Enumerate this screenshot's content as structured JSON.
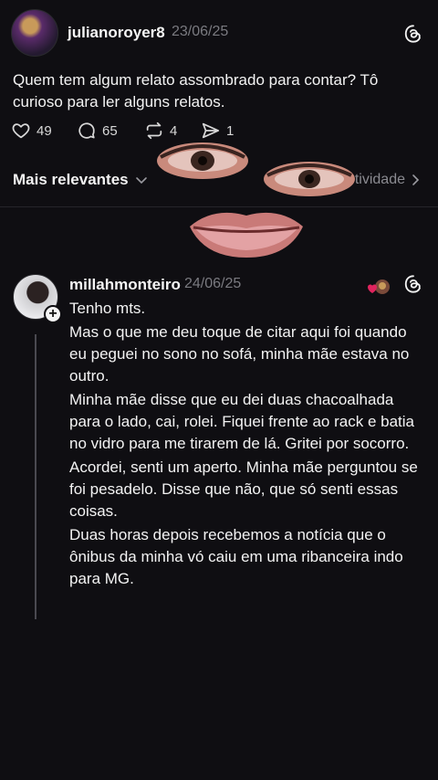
{
  "post": {
    "username": "julianoroyer8",
    "date": "23/06/25",
    "text": "Quem tem algum relato assombrado para contar? Tô curioso para ler alguns relatos.",
    "likes": "49",
    "comments": "65",
    "reposts": "4",
    "shares": "1"
  },
  "sort": {
    "label": "Mais relevantes",
    "activity": "tividade"
  },
  "reply": {
    "username": "millahmonteiro",
    "date": "24/06/25",
    "paragraphs": [
      "Tenho mts.",
      "Mas o que me deu toque de citar aqui foi quando eu peguei no sono no sofá, minha mãe estava no outro.",
      "Minha mãe disse que eu dei duas chacoalhada para o lado, cai, rolei. Fiquei frente ao rack e batia no vidro para me tirarem de lá. Gritei por socorro.",
      "Acordei, senti um aperto. Minha mãe perguntou se foi pesadelo. Disse que não, que só senti essas coisas.",
      "Duas horas depois recebemos a notícia que o ônibus da minha vó caiu em uma ribanceira indo para MG."
    ]
  },
  "icons": {
    "like": "heart-icon",
    "comment": "comment-bubble-icon",
    "repost": "repost-icon",
    "share": "send-icon",
    "threads": "threads-logo-icon"
  },
  "colors": {
    "background": "#0f0e12",
    "text": "#f3f3f3",
    "muted": "#7a7a80",
    "heart_react": "#e0245e"
  }
}
